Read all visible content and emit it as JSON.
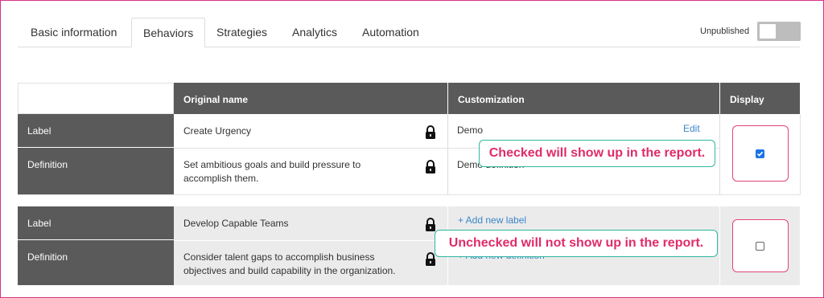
{
  "tabs": [
    {
      "label": "Basic information",
      "active": false
    },
    {
      "label": "Behaviors",
      "active": true
    },
    {
      "label": "Strategies",
      "active": false
    },
    {
      "label": "Analytics",
      "active": false
    },
    {
      "label": "Automation",
      "active": false
    }
  ],
  "publish": {
    "status_label": "Unpublished",
    "enabled": false
  },
  "table": {
    "headers": {
      "row": "",
      "original": "Original name",
      "customization": "Customization",
      "display": "Display"
    },
    "groups": [
      {
        "label_row": {
          "head": "Label",
          "original": "Create Urgency",
          "customization": "Demo",
          "action": "Edit"
        },
        "definition_row": {
          "head": "Definition",
          "original": "Set ambitious goals and build pressure to accomplish them.",
          "customization": "Demo definition"
        },
        "display_checked": true,
        "callout": "Checked will show up in the report."
      },
      {
        "label_row": {
          "head": "Label",
          "original": "Develop Capable Teams",
          "customization": "+ Add new label"
        },
        "definition_row": {
          "head": "Definition",
          "original": "Consider talent gaps to accomplish business objectives and build capability in the organization.",
          "customization": "+ Add new definition"
        },
        "display_checked": false,
        "callout": "Unchecked will not show up in the report."
      }
    ]
  },
  "colors": {
    "accent_border": "#e0457b",
    "callout_border": "#2fb9a0",
    "callout_text": "#e02b6a",
    "header_bg": "#5a5a5a",
    "link": "#3a86c8",
    "checkbox_on": "#1a73e8"
  },
  "icons": {
    "lock": "lock-icon"
  }
}
